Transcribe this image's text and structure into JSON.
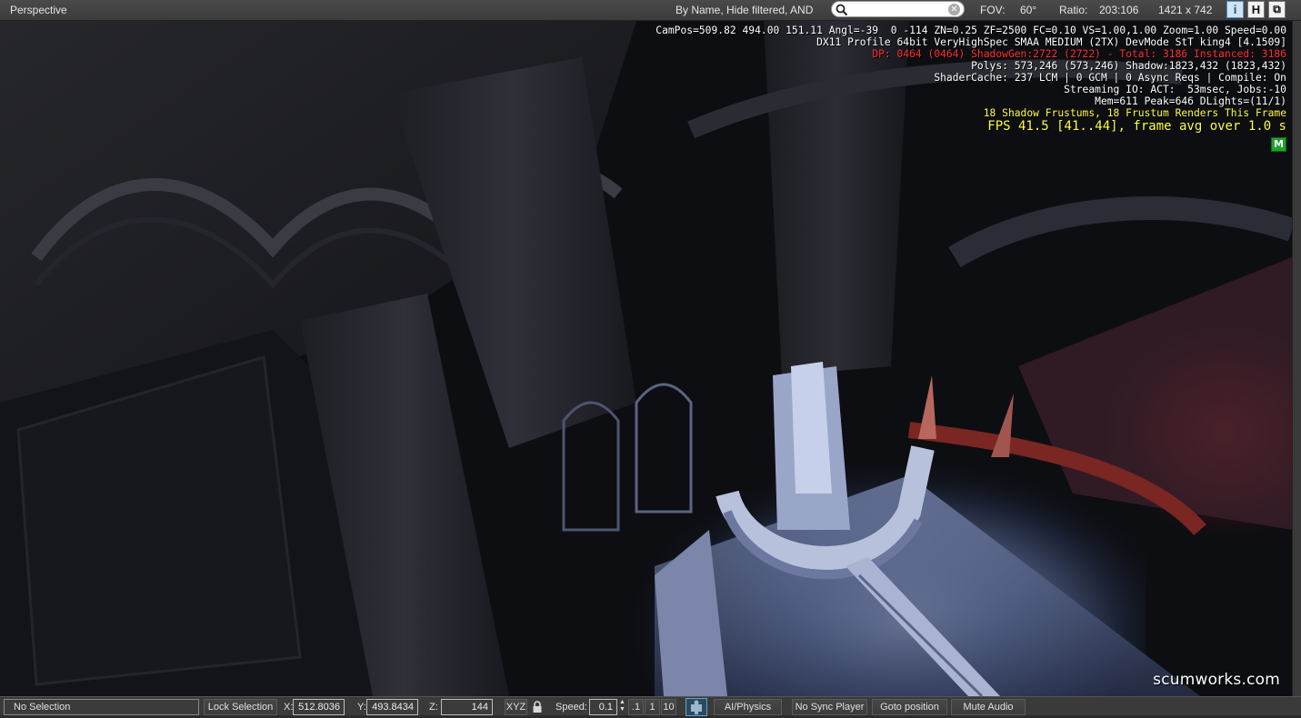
{
  "topbar": {
    "title": "Perspective",
    "filter_label": "By Name, Hide filtered, AND",
    "search_value": "",
    "fov_label": "FOV:",
    "fov_value": "60°",
    "ratio_label": "Ratio:",
    "ratio_value": "203:106",
    "resolution": "1421 x 742",
    "buttons": {
      "info": "i",
      "helpers": "H",
      "maximize": "⧉"
    }
  },
  "overlay": {
    "line1": "CamPos=509.82 494.00 151.11 Angl=-39  0 -114 ZN=0.25 ZF=2500 FC=0.10 VS=1.00,1.00 Zoom=1.00 Speed=0.00",
    "line2": "DX11 Profile 64bit VeryHighSpec SMAA MEDIUM (2TX) DevMode StT king4 [4.1509]",
    "line3": "DP: 0464 (0464) ShadowGen:2722 (2722) - Total: 3186 Instanced: 3186",
    "line4": "Polys: 573,246 (573,246) Shadow:1823,432 (1823,432)",
    "line5": "ShaderCache: 237 LCM | 0 GCM | 0 Async Reqs | Compile: On",
    "line6": "Streaming IO: ACT:  53msec, Jobs:-10",
    "line7": "Mem=611 Peak=646 DLights=(11/1)",
    "line8": "18 Shadow Frustums, 18 Frustum Renders This Frame",
    "fps": "FPS 41.5 [41..44], frame avg over 1.0 s",
    "badge": "M"
  },
  "watermark": "scumworks.com",
  "bottombar": {
    "selection": "No Selection",
    "lock_selection": "Lock Selection",
    "x_label": "X:",
    "x_value": "512.8036",
    "y_label": "Y:",
    "y_value": "493.8434",
    "z_label": "Z:",
    "z_value": "144",
    "xyz": "XYZ",
    "speed_label": "Speed:",
    "speed_value": "0.1",
    "speed_presets": [
      ".1",
      "1",
      "10"
    ],
    "ai_physics": "AI/Physics",
    "sync_player": "No Sync Player",
    "goto_position": "Goto position",
    "mute_audio": "Mute Audio"
  }
}
